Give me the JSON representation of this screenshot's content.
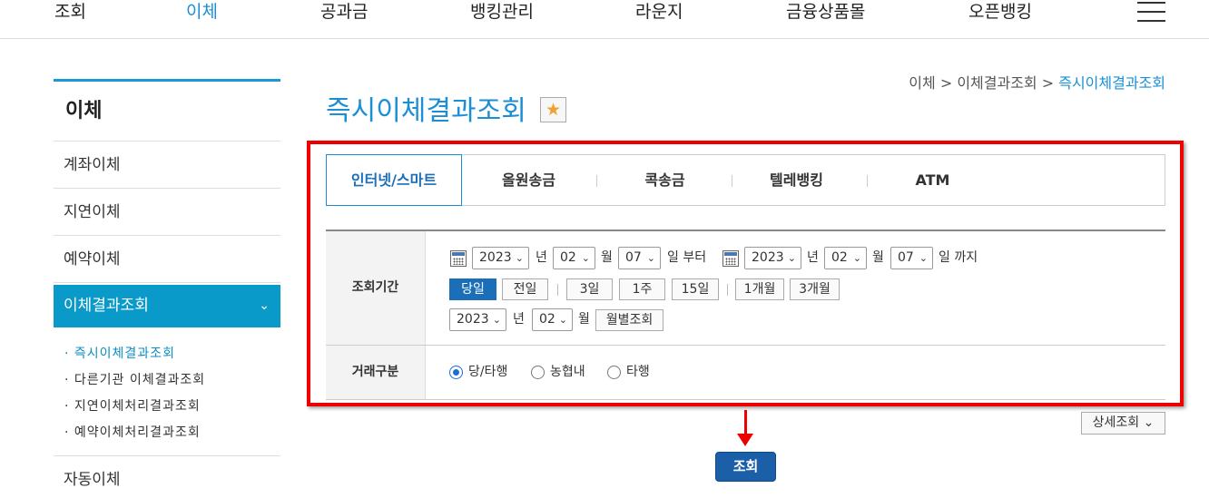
{
  "topnav": {
    "items": [
      "조회",
      "이체",
      "공과금",
      "뱅킹관리",
      "라운지",
      "금융상품몰",
      "오픈뱅킹"
    ],
    "active": "이체"
  },
  "sidebar": {
    "title": "이체",
    "items": [
      "계좌이체",
      "지연이체",
      "예약이체",
      "이체결과조회",
      "자동이체"
    ],
    "sub_items": [
      "즉시이체결과조회",
      "다른기관 이체결과조회",
      "지연이체처리결과조회",
      "예약이체처리결과조회"
    ]
  },
  "breadcrumb": [
    "이체",
    "이체결과조회",
    "즉시이체결과조회"
  ],
  "breadcrumb_sep": ">",
  "page": {
    "title": "즉시이체결과조회"
  },
  "tabs": [
    "인터넷/스마트",
    "올원송금",
    "콕송금",
    "텔레뱅킹",
    "ATM"
  ],
  "form": {
    "period_label": "조회기간",
    "start": {
      "year": "2023",
      "month": "02",
      "day": "07"
    },
    "end": {
      "year": "2023",
      "month": "02",
      "day": "07"
    },
    "unit_year": "년",
    "unit_month": "월",
    "from_text": "일 부터",
    "to_text": "일 까지",
    "quick_buttons": [
      "당일",
      "전일",
      "3일",
      "1주",
      "15일",
      "1개월",
      "3개월"
    ],
    "monthly": {
      "year": "2023",
      "month": "02",
      "button": "월별조회"
    },
    "type_label": "거래구분",
    "type_options": [
      "당/타행",
      "농협내",
      "타행"
    ],
    "type_selected": "당/타행"
  },
  "detail_button": "상세조회",
  "search_button": "조회",
  "colors": {
    "accent": "#1a8fd6",
    "sidebar_active": "#0a9ac9",
    "highlight": "#e00000"
  }
}
